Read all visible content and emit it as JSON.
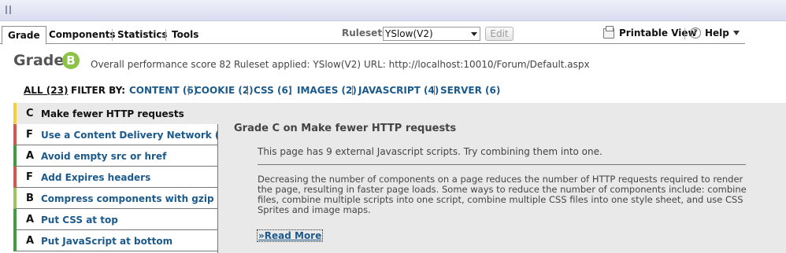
{
  "tabs": [
    "Grade",
    "Components",
    "Statistics",
    "Tools"
  ],
  "rulesets": {
    "label": "Rulesets",
    "selected": "YSlow(V2)",
    "edit_label": "Edit"
  },
  "toolbar": {
    "printable_label": "Printable View",
    "help_label": "Help"
  },
  "summary": {
    "title": "Grade",
    "grade": "B",
    "score_text": "Overall performance score 82",
    "ruleset_text": "Ruleset applied: YSlow(V2)",
    "url_text": "URL: http://localhost:10010/Forum/Default.aspx"
  },
  "filters": {
    "all": "ALL (23)",
    "filter_by": "FILTER BY:",
    "items": [
      "CONTENT (6)",
      "COOKIE (2)",
      "CSS (6)",
      "IMAGES (2)",
      "JAVASCRIPT (4)",
      "SERVER (6)"
    ]
  },
  "rules": [
    {
      "grade": "C",
      "title": "Make fewer HTTP requests"
    },
    {
      "grade": "F",
      "title": "Use a Content Delivery Network (CDN)"
    },
    {
      "grade": "A",
      "title": "Avoid empty src or href"
    },
    {
      "grade": "F",
      "title": "Add Expires headers"
    },
    {
      "grade": "B",
      "title": "Compress components with gzip"
    },
    {
      "grade": "A",
      "title": "Put CSS at top"
    },
    {
      "grade": "A",
      "title": "Put JavaScript at bottom"
    }
  ],
  "detail": {
    "title": "Grade C on Make fewer HTTP requests",
    "message": "This page has 9 external Javascript scripts.  Try combining them into one.",
    "description": "Decreasing the number of components on a page reduces the number of HTTP requests required to render the page, resulting in faster page loads. Some ways to reduce the number of components include: combine files, combine multiple scripts into one script, combine multiple CSS files into one style sheet, and use CSS Sprites and image maps.",
    "read_more": "»Read More"
  },
  "colors": {
    "grade_a": "#3f9d3f",
    "grade_b": "#9ac55a",
    "grade_c": "#f2d037",
    "grade_f": "#d9534f",
    "link": "#1c5a8c"
  }
}
